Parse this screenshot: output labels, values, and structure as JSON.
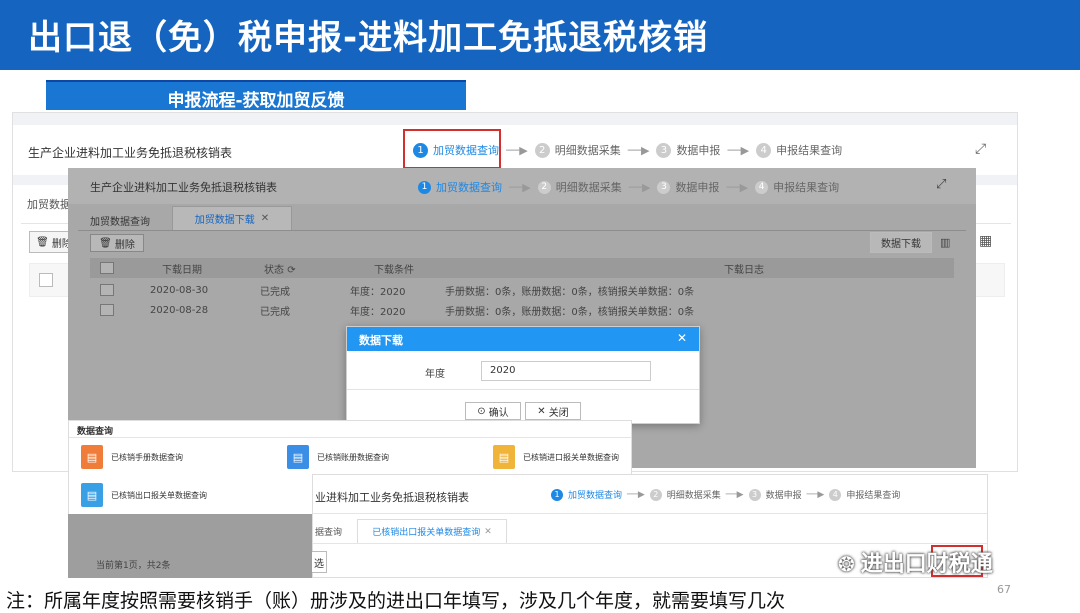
{
  "banner": {
    "title": "出口退（免）税申报-进料加工免抵退税核销"
  },
  "section_tab": "申报流程-获取加贸反馈",
  "back_panel": {
    "title": "生产企业进料加工业务免抵退税核销表",
    "steps": [
      {
        "num": "1",
        "label": "加贸数据查询"
      },
      {
        "num": "2",
        "label": "明细数据采集"
      },
      {
        "num": "3",
        "label": "数据申报"
      },
      {
        "num": "4",
        "label": "申报结果查询"
      }
    ],
    "tab_partial": "加贸数据",
    "delete_partial": "删除",
    "expand_icon": "expand-icon",
    "grid_icon": "grid-icon"
  },
  "mid_panel": {
    "title": "生产企业进料加工业务免抵退税核销表",
    "steps": [
      {
        "num": "1",
        "label": "加贸数据查询"
      },
      {
        "num": "2",
        "label": "明细数据采集"
      },
      {
        "num": "3",
        "label": "数据申报"
      },
      {
        "num": "4",
        "label": "申报结果查询"
      }
    ],
    "tabs": [
      "加贸数据查询",
      "加贸数据下载"
    ],
    "delete_label": "删除",
    "download_button": "数据下载",
    "columns": [
      "下载日期",
      "状态",
      "下载条件",
      "下载日志"
    ],
    "rows": [
      {
        "date": "2020-08-30",
        "status": "已完成",
        "cond": "年度：2020",
        "log": "手册数据：0条，账册数据：0条，核销报关单数据：0条"
      },
      {
        "date": "2020-08-28",
        "status": "已完成",
        "cond": "年度：2020",
        "log": "手册数据：0条，账册数据：0条，核销报关单数据：0条"
      }
    ]
  },
  "dialog": {
    "title": "数据下载",
    "year_label": "年度",
    "year_value": "2020",
    "confirm": "确认",
    "close": "关闭"
  },
  "query_panel": {
    "title": "数据查询",
    "items": [
      {
        "label": "已核销手册数据查询",
        "color": "#f07c3a"
      },
      {
        "label": "已核销账册数据查询",
        "color": "#3a8ee6"
      },
      {
        "label": "已核销进口报关单数据查询",
        "color": "#f0b43a"
      },
      {
        "label": "已核销出口报关单数据查询",
        "color": "#3aa0e6"
      }
    ]
  },
  "front_panel": {
    "title_partial": "业进料加工业务免抵退税核销表",
    "steps": [
      {
        "num": "1",
        "label": "加贸数据查询"
      },
      {
        "num": "2",
        "label": "明细数据采集"
      },
      {
        "num": "3",
        "label": "数据申报"
      },
      {
        "num": "4",
        "label": "申报结果查询"
      }
    ],
    "tab_partial": "据查询",
    "tab_active": "已核销出口报关单数据查询",
    "btn_partial": "选"
  },
  "pager_text": "当前第1页，共2条",
  "note": "注：所属年度按照需要核销手（账）册涉及的进出口年填写，涉及几个年度，就需要填写几次",
  "watermark": "进出口财税通",
  "page_number": "67"
}
